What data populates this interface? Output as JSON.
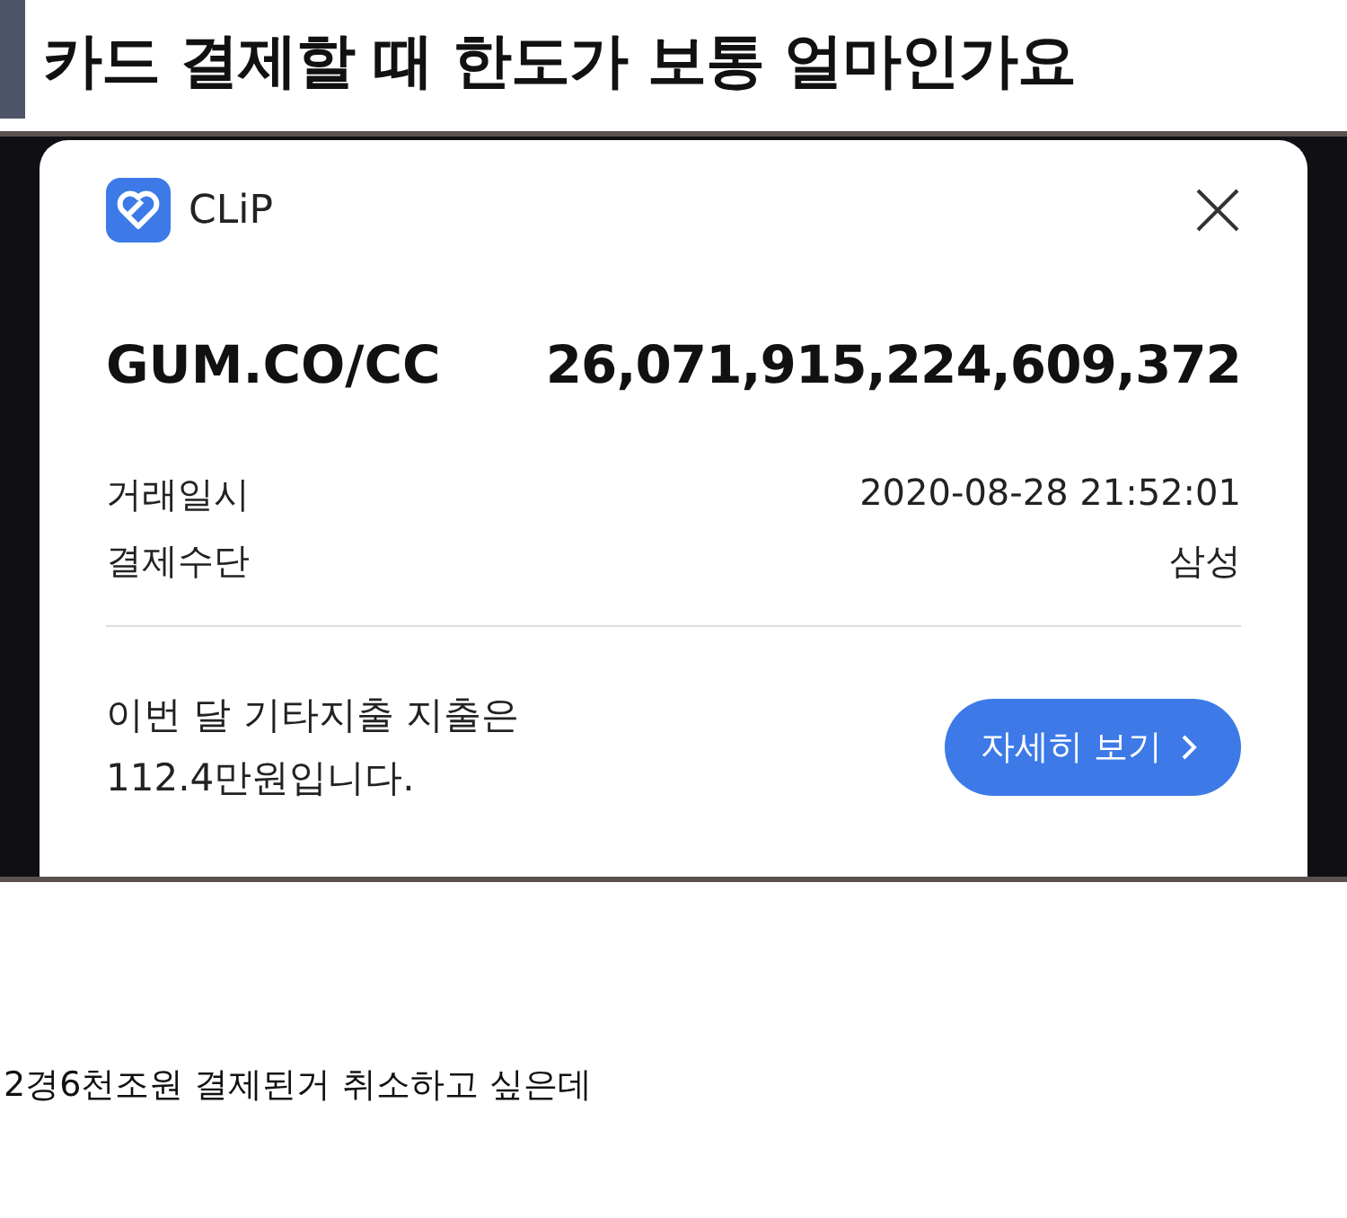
{
  "post": {
    "title": "카드 결제할 때 한도가 보통 얼마인가요"
  },
  "notification": {
    "app_name": "CLiP",
    "merchant": "GUM.CO/CC",
    "amount": "26,071,915,224,609,372",
    "details": [
      {
        "label": "거래일시",
        "value": "2020-08-28 21:52:01"
      },
      {
        "label": "결제수단",
        "value": "삼성"
      }
    ],
    "message": "이번 달 기타지출 지출은\n112.4만원입니다.",
    "button": {
      "label": "자세히 보기"
    }
  },
  "body": "2경6천조원 결제된거 취소하고 싶은데"
}
